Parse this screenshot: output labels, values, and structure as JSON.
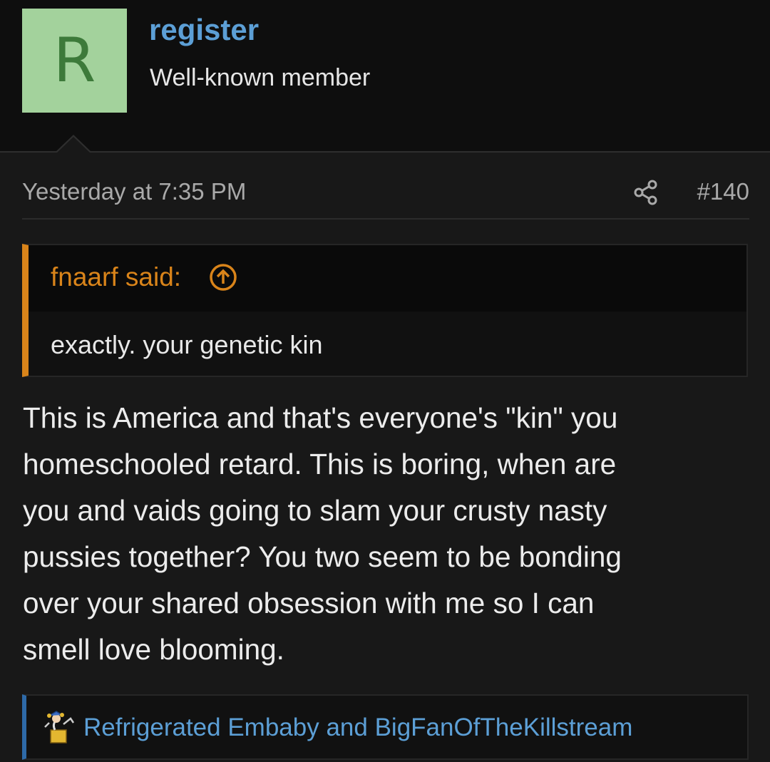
{
  "user": {
    "avatar_letter": "R",
    "avatar_bg": "#a3d29c",
    "avatar_fg": "#3d7a3a",
    "username": "register",
    "title": "Well-known member"
  },
  "post": {
    "time": "Yesterday at 7:35 PM",
    "share_icon": "share-icon",
    "number": "#140"
  },
  "quote": {
    "author_label": "fnaarf said:",
    "expand_icon": "arrow-up-circle-icon",
    "text": "exactly. your genetic kin",
    "accent": "#d9841a"
  },
  "message": {
    "text": "This is America and that's everyone's \"kin\" you\nhomeschooled retard. This is boring, when are\nyou and vaids going to slam your crusty nasty\npussies together? You two seem to be bonding\nover your shared obsession with me so I can\nsmell love blooming."
  },
  "reactions": {
    "icon": "jester-jack-in-the-box-icon",
    "users": "Refrigerated Embaby and BigFanOfTheKillstream",
    "accent": "#2e6aa8"
  }
}
